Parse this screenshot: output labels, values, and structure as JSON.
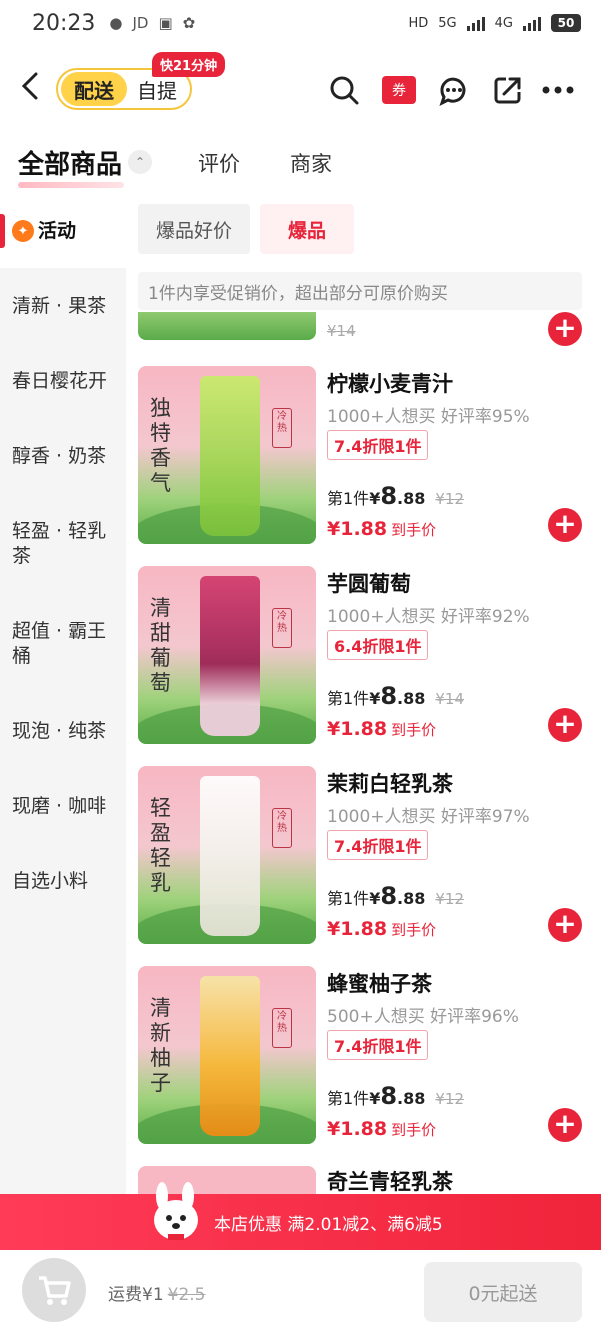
{
  "status": {
    "time": "20:23",
    "apps": [
      "JD"
    ],
    "right_labels": [
      "HD",
      "5G",
      "4G"
    ],
    "battery": "50"
  },
  "nav": {
    "delivery_label": "配送",
    "pickup_label": "自提",
    "fast_tag": "快21分钟",
    "coupon_label": "券"
  },
  "categories": {
    "all_label": "全部商品",
    "review_label": "评价",
    "merchant_label": "商家"
  },
  "sidebar": {
    "items": [
      {
        "label": "活动"
      },
      {
        "label": "清新 · 果茶"
      },
      {
        "label": "春日樱花开"
      },
      {
        "label": "醇香 · 奶茶"
      },
      {
        "label": "轻盈 · 轻乳茶"
      },
      {
        "label": "超值 · 霸王桶"
      },
      {
        "label": "现泡 · 纯茶"
      },
      {
        "label": "现磨 · 咖啡"
      },
      {
        "label": "自选小料"
      }
    ]
  },
  "subtabs": {
    "tab1": "爆品好价",
    "tab2": "爆品"
  },
  "notice": "1件内享受促销价，超出部分可原价购买",
  "partial_product": {
    "old_price": "¥14"
  },
  "products": [
    {
      "name": "柠檬小麦青汁",
      "sub": "1000+人想买 好评率95%",
      "discount": "7.4折限1件",
      "price_prefix": "第1件",
      "currency": "¥",
      "price_int": "8",
      "price_dec": ".88",
      "old_price": "¥12",
      "final_price": "¥1.88",
      "final_label": "到手价",
      "image_text": "独特香气",
      "seal": "冷热",
      "cup_color": "#9ad34a"
    },
    {
      "name": "芋圆葡萄",
      "sub": "1000+人想买 好评率92%",
      "discount": "6.4折限1件",
      "price_prefix": "第1件",
      "currency": "¥",
      "price_int": "8",
      "price_dec": ".88",
      "old_price": "¥14",
      "final_price": "¥1.88",
      "final_label": "到手价",
      "image_text": "清甜葡萄",
      "seal": "冷热",
      "cup_color": "#b8245a"
    },
    {
      "name": "茉莉白轻乳茶",
      "sub": "1000+人想买 好评率97%",
      "discount": "7.4折限1件",
      "price_prefix": "第1件",
      "currency": "¥",
      "price_int": "8",
      "price_dec": ".88",
      "old_price": "¥12",
      "final_price": "¥1.88",
      "final_label": "到手价",
      "image_text": "轻盈轻乳",
      "seal": "冷热",
      "cup_color": "#f2efe8"
    },
    {
      "name": "蜂蜜柚子茶",
      "sub": "500+人想买 好评率96%",
      "discount": "7.4折限1件",
      "price_prefix": "第1件",
      "currency": "¥",
      "price_int": "8",
      "price_dec": ".88",
      "old_price": "¥12",
      "final_price": "¥1.88",
      "final_label": "到手价",
      "image_text": "清新柚子",
      "seal": "冷热",
      "cup_color": "#f5a623"
    }
  ],
  "next_product": {
    "name": "奇兰青轻乳茶"
  },
  "promo": {
    "text": "本店优惠 满2.01减2、满6减5"
  },
  "bottom": {
    "fee_label": "运费¥1",
    "fee_old": "¥2.5",
    "min_label": "0元起送"
  },
  "colors": {
    "accent": "#e8243a",
    "toggle": "#ffd24a"
  }
}
